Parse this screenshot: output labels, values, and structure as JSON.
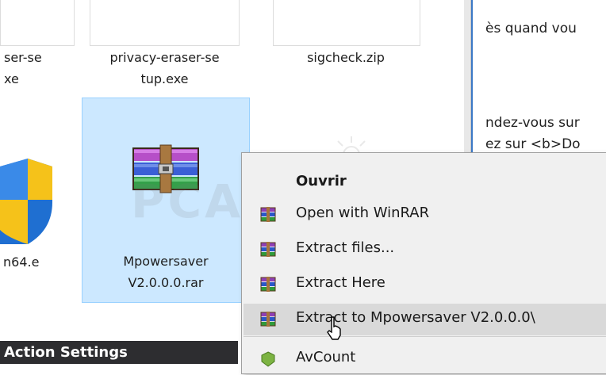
{
  "explorer": {
    "files": [
      {
        "label_line1": "ser-se",
        "label_line2": "xe"
      },
      {
        "label_line1": "privacy-eraser-se",
        "label_line2": "tup.exe"
      },
      {
        "label_line1": "sigcheck.zip",
        "label_line2": ""
      },
      {
        "label_line1": "n64.e",
        "label_line2": ""
      },
      {
        "label_line1": "Mpowersaver",
        "label_line2": "V2.0.0.0.rar"
      }
    ],
    "watermark": "PCASTUCES",
    "action_bar_label": "Action Settings"
  },
  "document": {
    "lines": [
      "ès quand vou",
      "ndez-vous sur",
      "ez sur <b>Do"
    ]
  },
  "context_menu": {
    "items": [
      {
        "label": "Ouvrir",
        "icon": "none",
        "bold": true
      },
      {
        "label": "Open with WinRAR",
        "icon": "winrar-icon"
      },
      {
        "label": "Extract files...",
        "icon": "winrar-icon"
      },
      {
        "label": "Extract Here",
        "icon": "winrar-icon"
      },
      {
        "label": "Extract to Mpowersaver V2.0.0.0\\",
        "icon": "winrar-icon",
        "highlighted": true
      },
      {
        "label": "AvCount",
        "icon": "avast-icon"
      }
    ]
  },
  "colors": {
    "selection_bg": "#cce8ff",
    "selection_border": "#99d1ff",
    "menu_bg": "#f0f0f0",
    "menu_highlight": "#d9d9d9",
    "action_bar_bg": "#2d2d30"
  }
}
